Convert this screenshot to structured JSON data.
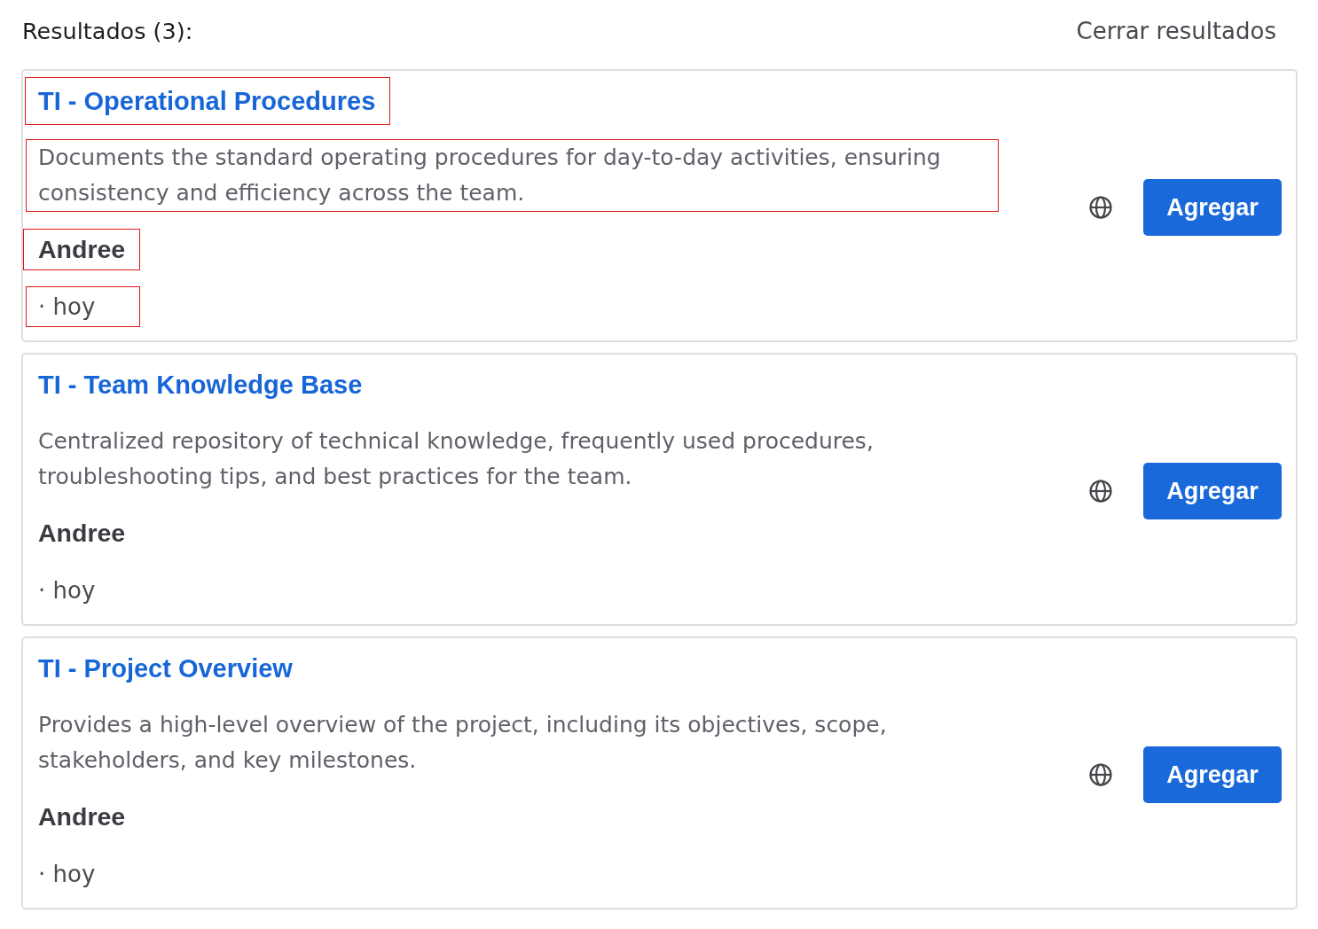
{
  "header": {
    "title": "Resultados (3):",
    "close_link": "Cerrar resultados"
  },
  "results": [
    {
      "title": "TI - Operational Procedures",
      "description": "Documents the standard operating procedures for day-to-day activities, ensuring consistency and efficiency across the team.",
      "author": "Andree",
      "date": "· hoy",
      "button": "Agregar",
      "outlined": true
    },
    {
      "title": "TI - Team Knowledge Base",
      "description": "Centralized repository of technical knowledge, frequently used procedures, troubleshooting tips, and best practices for the team.",
      "author": "Andree",
      "date": "· hoy",
      "button": "Agregar",
      "outlined": false
    },
    {
      "title": "TI - Project Overview",
      "description": "Provides a high-level overview of the project, including its objectives, scope, stakeholders, and key milestones.",
      "author": "Andree",
      "date": "· hoy",
      "button": "Agregar",
      "outlined": false
    }
  ]
}
